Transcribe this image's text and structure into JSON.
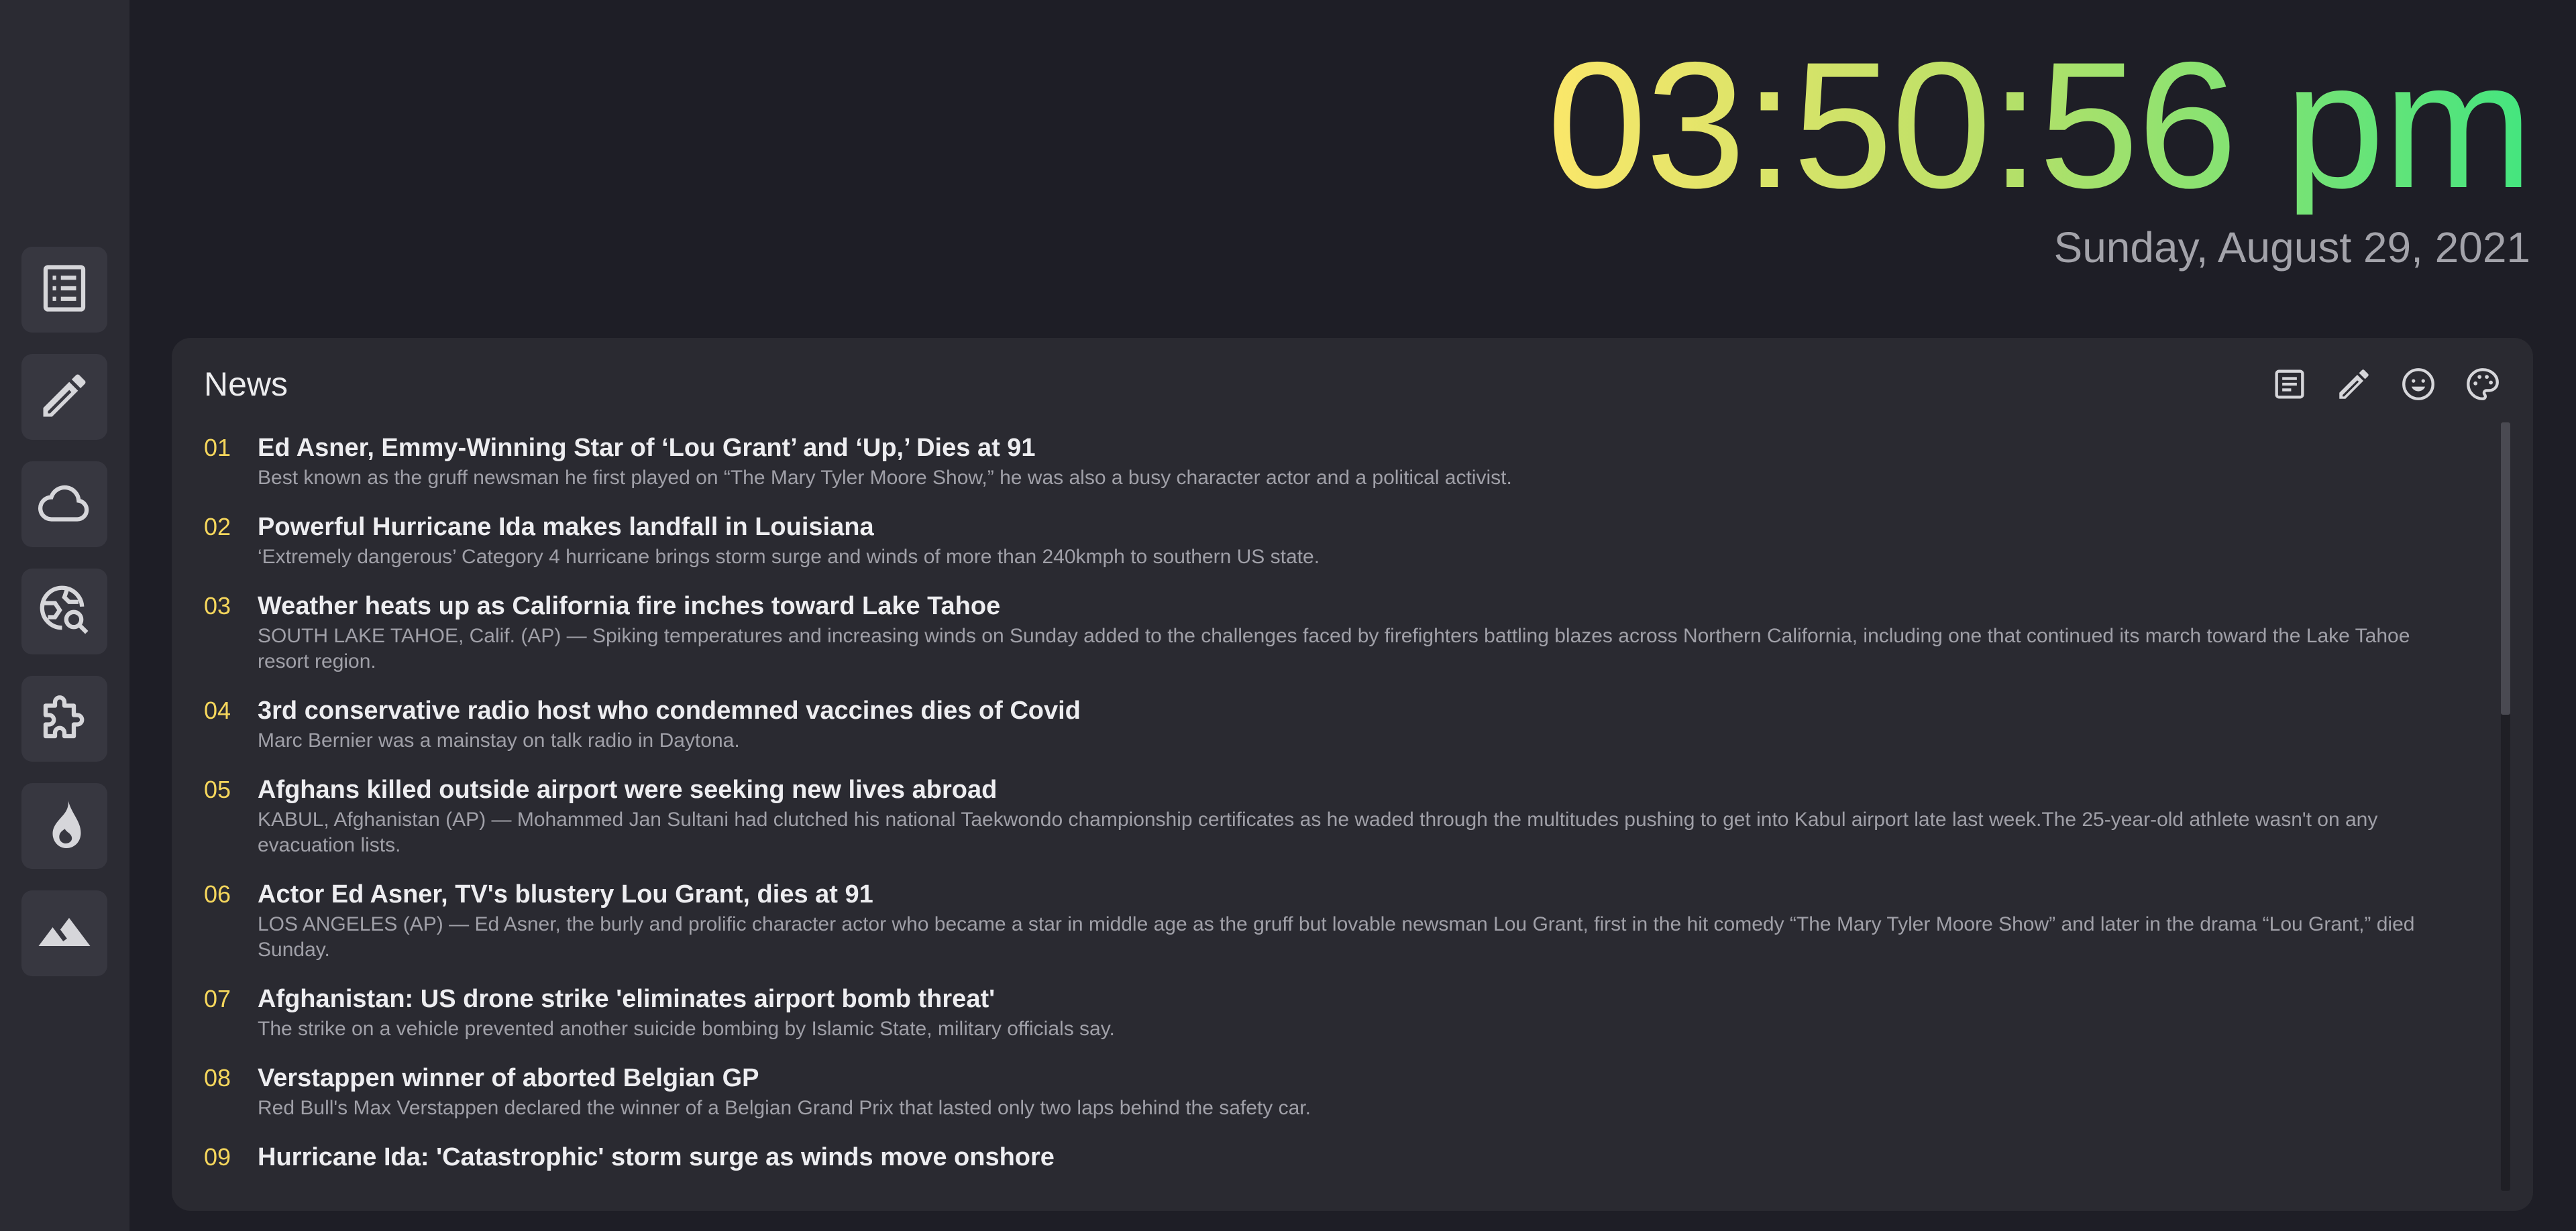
{
  "clock": {
    "time": "03:50:56 pm",
    "date": "Sunday, August 29, 2021",
    "gradient_colors": [
      "#fbe76a",
      "#43e57f"
    ]
  },
  "sidebar": {
    "items": [
      {
        "icon": "list-icon",
        "label": "News"
      },
      {
        "icon": "pencil-icon",
        "label": "Notes"
      },
      {
        "icon": "cloud-icon",
        "label": "Weather"
      },
      {
        "icon": "globe-search-icon",
        "label": "Search"
      },
      {
        "icon": "puzzle-icon",
        "label": "Extensions"
      },
      {
        "icon": "flame-icon",
        "label": "Trending"
      },
      {
        "icon": "mountain-icon",
        "label": "Background"
      }
    ]
  },
  "panel": {
    "title": "News",
    "tools": [
      "news-source-icon",
      "edit-icon",
      "emoji-icon",
      "palette-icon"
    ]
  },
  "news": [
    {
      "num": "01",
      "headline": "Ed Asner, Emmy-Winning Star of ‘Lou Grant’ and ‘Up,’ Dies at 91",
      "summary": "Best known as the gruff newsman he first played on “The Mary Tyler Moore Show,” he was also a busy character actor and a political activist."
    },
    {
      "num": "02",
      "headline": "Powerful Hurricane Ida makes landfall in Louisiana",
      "summary": "‘Extremely dangerous’ Category 4 hurricane brings storm surge and winds of more than 240kmph to southern US state."
    },
    {
      "num": "03",
      "headline": "Weather heats up as California fire inches toward Lake Tahoe",
      "summary": "SOUTH LAKE TAHOE, Calif. (AP) — Spiking temperatures and increasing winds on Sunday added to the challenges faced by firefighters battling blazes across Northern California, including one that continued its march toward the Lake Tahoe resort region."
    },
    {
      "num": "04",
      "headline": "3rd conservative radio host who condemned vaccines dies of Covid",
      "summary": "Marc Bernier was a mainstay on talk radio in Daytona."
    },
    {
      "num": "05",
      "headline": "Afghans killed outside airport were seeking new lives abroad",
      "summary": "KABUL, Afghanistan (AP) — Mohammed Jan Sultani had clutched his national Taekwondo championship certificates as he waded through the multitudes pushing to get into Kabul airport late last week.The 25-year-old athlete wasn't on any evacuation lists."
    },
    {
      "num": "06",
      "headline": "Actor Ed Asner, TV's blustery Lou Grant, dies at 91",
      "summary": "LOS ANGELES (AP) — Ed Asner, the burly and prolific character actor who became a star in middle age as the gruff but lovable newsman Lou Grant, first in the hit comedy “The Mary Tyler Moore Show” and later in the drama “Lou Grant,” died Sunday."
    },
    {
      "num": "07",
      "headline": "Afghanistan: US drone strike 'eliminates airport bomb threat'",
      "summary": "The strike on a vehicle prevented another suicide bombing by Islamic State, military officials say."
    },
    {
      "num": "08",
      "headline": "Verstappen winner of aborted Belgian GP",
      "summary": "Red Bull's Max Verstappen declared the winner of a Belgian Grand Prix that lasted only two laps behind the safety car."
    },
    {
      "num": "09",
      "headline": "Hurricane Ida: 'Catastrophic' storm surge as winds move onshore",
      "summary": ""
    }
  ]
}
